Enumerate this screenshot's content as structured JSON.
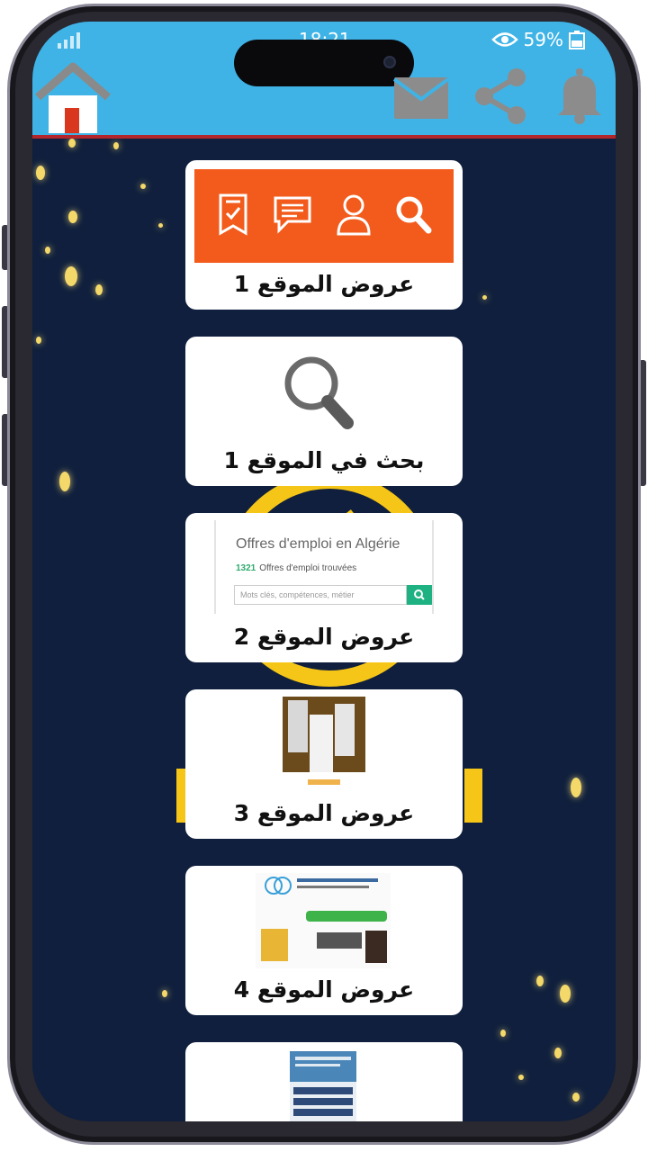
{
  "status": {
    "time": "18:21",
    "battery": "59%"
  },
  "header": {
    "icons": [
      "home-icon",
      "mail-icon",
      "share-icon",
      "bell-icon"
    ]
  },
  "cards": [
    {
      "label": "عروض الموقع 1",
      "image": "orange-app-banner"
    },
    {
      "label": "بحث في الموقع 1",
      "image": "magnifier-icon"
    },
    {
      "label": "عروض الموقع 2",
      "image": "website-screenshot"
    },
    {
      "label": "عروض الموقع 3",
      "image": "app-screenshot"
    },
    {
      "label": "عروض الموقع 4",
      "image": "agency-screenshot"
    },
    {
      "label": "",
      "image": "form-screenshot"
    }
  ],
  "card2_screenshot": {
    "title": "Offres d'emploi en Algérie",
    "count": "1321",
    "count_text": "Offres d'emploi trouvées",
    "search_placeholder": "Mots clés, compétences, métier"
  },
  "colors": {
    "appbar": "#3fb3e6",
    "appbar_border": "#b3262b",
    "background": "#0f1f3d",
    "orange": "#f25b1c"
  }
}
